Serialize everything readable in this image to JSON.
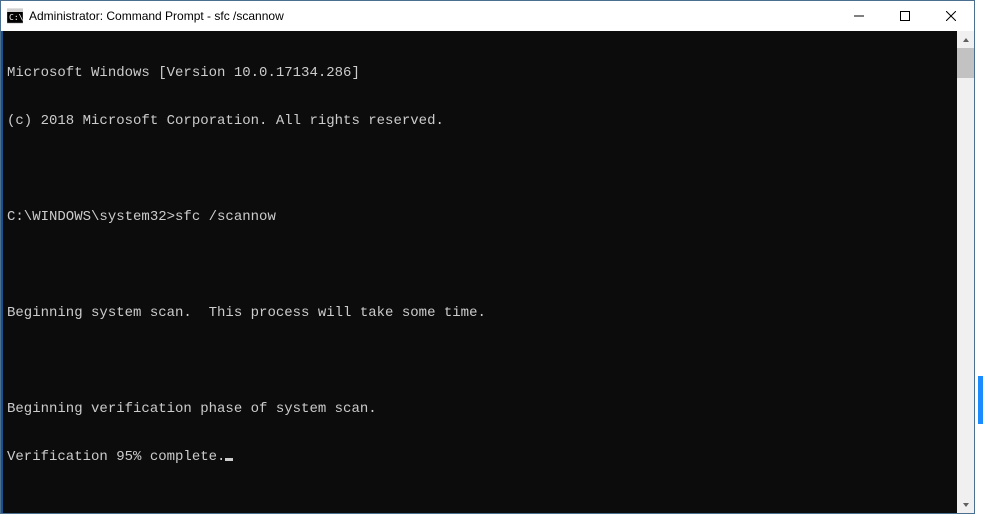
{
  "titlebar": {
    "title": "Administrator: Command Prompt - sfc  /scannow"
  },
  "terminal": {
    "lines": [
      "Microsoft Windows [Version 10.0.17134.286]",
      "(c) 2018 Microsoft Corporation. All rights reserved.",
      "",
      "C:\\WINDOWS\\system32>sfc /scannow",
      "",
      "Beginning system scan.  This process will take some time.",
      "",
      "Beginning verification phase of system scan.",
      "Verification 95% complete."
    ]
  }
}
